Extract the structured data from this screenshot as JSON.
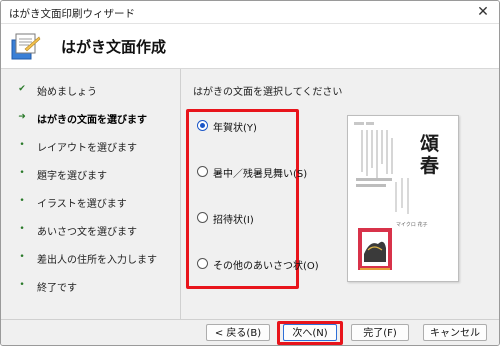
{
  "window": {
    "title": "はがき文面印刷ウィザード",
    "close_glyph": "✕"
  },
  "header": {
    "title": "はがき文面作成",
    "icon": "wizard-icon"
  },
  "sidebar": {
    "items": [
      {
        "label": "始めましょう",
        "mark": "✔",
        "state": "done"
      },
      {
        "label": "はがきの文面を選びます",
        "mark": "➜",
        "state": "current"
      },
      {
        "label": "レイアウトを選びます",
        "mark": "•",
        "state": "pending"
      },
      {
        "label": "題字を選びます",
        "mark": "•",
        "state": "pending"
      },
      {
        "label": "イラストを選びます",
        "mark": "•",
        "state": "pending"
      },
      {
        "label": "あいさつ文を選びます",
        "mark": "•",
        "state": "pending"
      },
      {
        "label": "差出人の住所を入力します",
        "mark": "•",
        "state": "pending"
      },
      {
        "label": "終了です",
        "mark": "•",
        "state": "pending"
      }
    ]
  },
  "main": {
    "prompt": "はがきの文面を選択してください",
    "options": [
      {
        "label": "年賀状(Y)",
        "checked": true
      },
      {
        "label": "暑中／残暑見舞い(S)",
        "checked": false
      },
      {
        "label": "招待状(I)",
        "checked": false
      },
      {
        "label": "その他のあいさつ状(O)",
        "checked": false
      }
    ],
    "preview": {
      "title_kanji": "頌春",
      "sender_name": "マイクロ 花子"
    }
  },
  "footer": {
    "back": "< 戻る(B)",
    "next": "次へ(N) >",
    "finish": "完了(F)",
    "cancel": "キャンセル"
  },
  "colors": {
    "highlight": "#e8141b",
    "accent": "#1a56c8",
    "preview_red": "#d8324a"
  }
}
